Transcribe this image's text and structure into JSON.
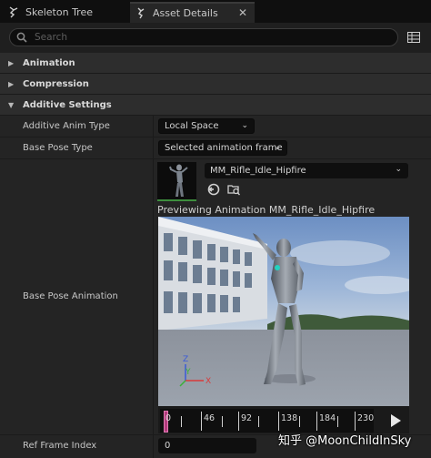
{
  "tabs": [
    {
      "label": "Skeleton Tree",
      "icon": "skeleton-icon",
      "active": false
    },
    {
      "label": "Asset Details",
      "icon": "details-icon",
      "active": true,
      "close": "✕"
    }
  ],
  "search": {
    "placeholder": "Search"
  },
  "categories": {
    "animation": {
      "label": "Animation",
      "expanded": false
    },
    "compression": {
      "label": "Compression",
      "expanded": false
    },
    "additive": {
      "label": "Additive Settings",
      "expanded": true
    }
  },
  "properties": {
    "additive_anim_type": {
      "label": "Additive Anim Type",
      "value": "Local Space"
    },
    "base_pose_type": {
      "label": "Base Pose Type",
      "value": "Selected animation frame"
    },
    "base_pose_animation": {
      "label": "Base Pose Animation",
      "asset": "MM_Rifle_Idle_Hipfire",
      "preview_label": "Previewing Animation MM_Rifle_Idle_Hipfire"
    },
    "ref_frame_index": {
      "label": "Ref Frame Index",
      "value": "0"
    }
  },
  "timeline": {
    "tick_labels": [
      "0",
      "46",
      "92",
      "138",
      "184",
      "230"
    ],
    "scrub_frame": 0
  },
  "viewport": {
    "gizmo_labels": {
      "x": "X",
      "y": "Y",
      "z": "Z"
    }
  },
  "watermark": "知乎 @MoonChildInSky",
  "colors": {
    "accent": "#3e8f3e",
    "scrub": "#b23b7c",
    "panel": "#242424",
    "category": "#2d2d2d"
  }
}
